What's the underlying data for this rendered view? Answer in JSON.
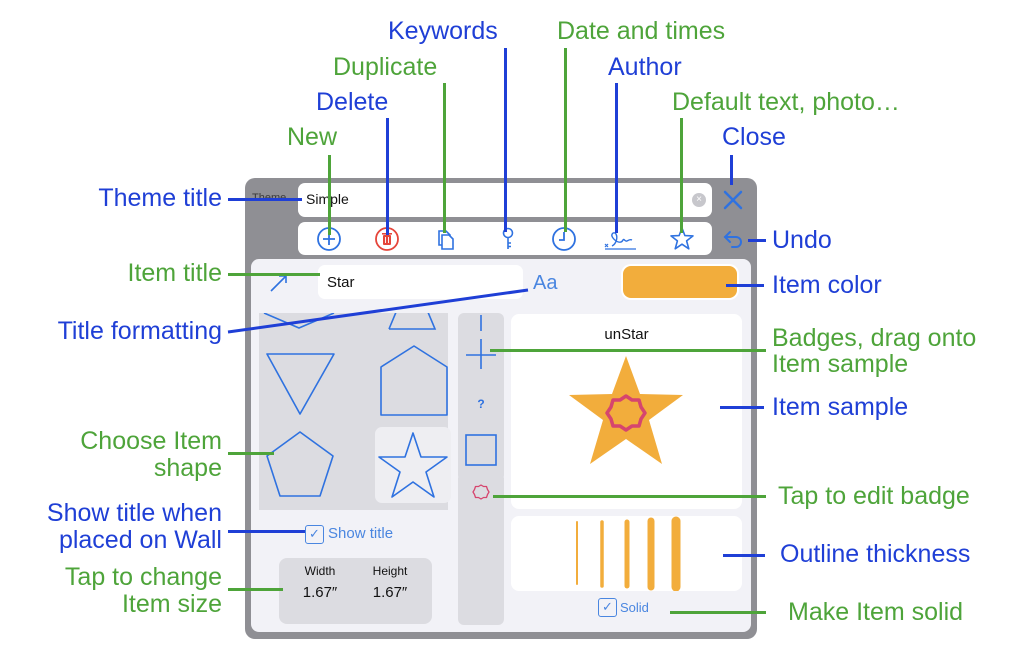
{
  "annotations": {
    "keywords": "Keywords",
    "date_times": "Date and times",
    "duplicate": "Duplicate",
    "author": "Author",
    "delete": "Delete",
    "default_text": "Default text, photo…",
    "new": "New",
    "close": "Close",
    "theme_title": "Theme title",
    "undo": "Undo",
    "item_title": "Item title",
    "item_color": "Item color",
    "title_formatting": "Title formatting",
    "badges_line1": "Badges, drag onto",
    "badges_line2": "Item sample",
    "item_sample": "Item sample",
    "choose_shape_line1": "Choose Item",
    "choose_shape_line2": "shape",
    "tap_edit_badge": "Tap to edit badge",
    "show_title_line1": "Show title when",
    "show_title_line2": "placed on Wall",
    "outline_thickness": "Outline thickness",
    "tap_size_line1": "Tap to change",
    "tap_size_line2": "Item size",
    "make_solid": "Make Item solid"
  },
  "colors": {
    "annotation_blue": "#1f3fd6",
    "annotation_green": "#4ea43a",
    "ui_blue": "#4a86e0",
    "delete_red": "#e5453a",
    "item_color": "#f2ad3c",
    "badge_pink": "#d6456e"
  },
  "panel": {
    "theme_label": "Theme",
    "theme_value": "Simple",
    "toolbar": [
      "plus-circle-icon",
      "trash-icon",
      "duplicate-icon",
      "key-icon",
      "clock-icon",
      "signature-icon",
      "star-icon"
    ],
    "item_title_value": "Star",
    "format_button": "Aa",
    "shapes": [
      "triangle-up",
      "triangle-down",
      "pentagon",
      "house",
      "pentagon-small",
      "star"
    ],
    "selected_shape": "star",
    "badges": [
      "line",
      "plus",
      "question",
      "square"
    ],
    "badge_question_label": "?",
    "sample_title": "unStar",
    "outline_thickness_options": 5,
    "show_title_label": "Show title",
    "show_title_checked": true,
    "solid_label": "Solid",
    "solid_checked": true,
    "size": {
      "width_label": "Width",
      "width_value": "1.67″",
      "height_label": "Height",
      "height_value": "1.67″"
    }
  }
}
